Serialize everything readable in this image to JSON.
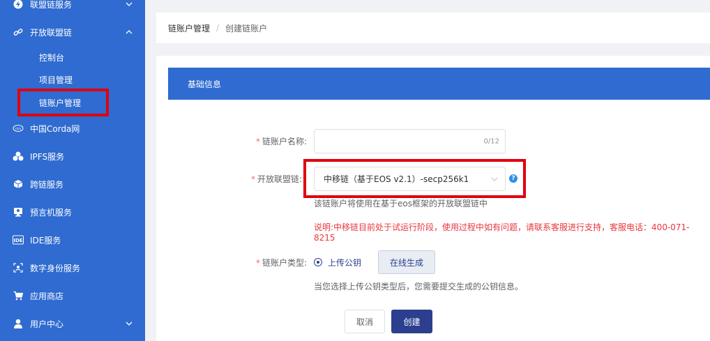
{
  "sidebar": {
    "items": [
      {
        "label": "联盟链服务",
        "icon": "lightning-icon"
      },
      {
        "label": "开放联盟链",
        "icon": "link-icon"
      },
      {
        "label": "中国Corda网",
        "icon": "corda-icon"
      },
      {
        "label": "IPFS服务",
        "icon": "cluster-icon"
      },
      {
        "label": "跨链服务",
        "icon": "cube-icon"
      },
      {
        "label": "预言机服务",
        "icon": "monitor-icon"
      },
      {
        "label": "IDE服务",
        "icon": "ide-icon"
      },
      {
        "label": "数字身份服务",
        "icon": "id-scan-icon"
      },
      {
        "label": "应用商店",
        "icon": "cart-icon"
      },
      {
        "label": "用户中心",
        "icon": "user-icon"
      }
    ],
    "sub_items": [
      {
        "label": "控制台"
      },
      {
        "label": "项目管理"
      },
      {
        "label": "链账户管理"
      }
    ]
  },
  "breadcrumb": {
    "parent": "链账户管理",
    "separator": "/",
    "current": "创建链账户"
  },
  "section": {
    "title": "基础信息"
  },
  "form": {
    "name_label": "链账户名称:",
    "name_counter": "0/12",
    "chain_label": "开放联盟链:",
    "chain_value": "中移链（基于EOS v2.1）-secp256k1",
    "help_glyph": "?",
    "chain_hint": "该链账户将使用在基于eos框架的开放联盟链中",
    "chain_warning": "说明:中移链目前处于试运行阶段，使用过程中如有问题，请联系客服进行支持，客服电话：400-071-8215",
    "type_label": "链账户类型:",
    "type_option": "上传公钥",
    "generate_btn": "在线生成",
    "type_hint": "当您选择上传公钥类型后，您需要提交生成的公钥信息。",
    "required_mark": "*"
  },
  "actions": {
    "cancel": "取消",
    "create": "创建"
  },
  "colors": {
    "sidebar": "#2f6bd0",
    "primary": "#2b3f8e",
    "highlight": "#e0000f",
    "warning": "#e8363d"
  }
}
